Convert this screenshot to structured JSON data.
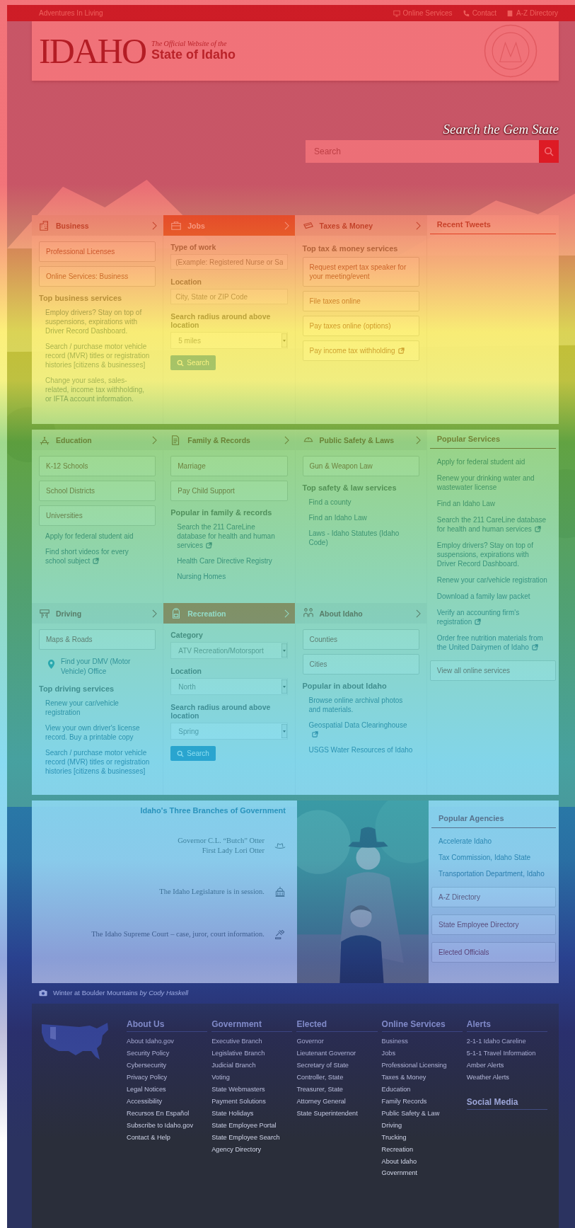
{
  "top_bar": {
    "tagline": "Adventures In Living",
    "links": [
      {
        "label": "Online Services"
      },
      {
        "label": "Contact"
      },
      {
        "label": "A-Z Directory"
      }
    ]
  },
  "header": {
    "logo": "IDAHO",
    "subtitle": "The Official Website of the",
    "title": "State of Idaho"
  },
  "hero": {
    "heading": "Search the Gem State",
    "search": {
      "placeholder": "Search"
    }
  },
  "sections": [
    {
      "title": "Business",
      "kind": "links",
      "blocks": [
        {
          "kind": "button",
          "label": "Professional Licenses"
        },
        {
          "kind": "button",
          "label": "Online Services: Business"
        },
        {
          "kind": "heading",
          "text": "Top business services"
        },
        {
          "kind": "link",
          "label": "Employ drivers? Stay on top of suspensions, expirations with Driver Record Dashboard."
        },
        {
          "kind": "link",
          "label": "Search / purchase motor vehicle record (MVR) titles or registration histories [citizens & businesses]"
        },
        {
          "kind": "link",
          "label": "Change your sales, sales-related, income tax withholding, or IFTA account information."
        }
      ]
    },
    {
      "title": "Jobs",
      "kind": "form",
      "blocks": [
        {
          "kind": "label",
          "text": "Type of work"
        },
        {
          "kind": "input",
          "placeholder": "(Example: Registered Nurse or Sa"
        },
        {
          "kind": "label",
          "text": "Location"
        },
        {
          "kind": "input",
          "placeholder": "City, State or ZIP Code"
        },
        {
          "kind": "label",
          "text": "Search radius around above location"
        },
        {
          "kind": "select",
          "value": "5 miles"
        },
        {
          "kind": "search_button",
          "label": "Search"
        }
      ]
    },
    {
      "title": "Taxes & Money",
      "kind": "links",
      "blocks": [
        {
          "kind": "heading",
          "text": "Top tax & money services"
        },
        {
          "kind": "button",
          "label": "Request expert tax speaker for your meeting/event"
        },
        {
          "kind": "button",
          "label": "File taxes online"
        },
        {
          "kind": "button",
          "label": "Pay taxes online (options)"
        },
        {
          "kind": "button",
          "label": "Pay income tax withholding",
          "external": true
        }
      ]
    },
    {
      "title": "Education",
      "kind": "links",
      "blocks": [
        {
          "kind": "button",
          "label": "K-12 Schools"
        },
        {
          "kind": "button",
          "label": "School Districts"
        },
        {
          "kind": "button",
          "label": "Universities"
        },
        {
          "kind": "link",
          "label": "Apply for federal student aid"
        },
        {
          "kind": "link",
          "label": "Find short videos for every school subject",
          "external": true
        }
      ]
    },
    {
      "title": "Family & Records",
      "kind": "links",
      "blocks": [
        {
          "kind": "button",
          "label": "Marriage"
        },
        {
          "kind": "button",
          "label": "Pay Child Support"
        },
        {
          "kind": "heading",
          "text": "Popular in family & records"
        },
        {
          "kind": "link",
          "label": "Search the 211 CareLine database for health and human services",
          "external": true
        },
        {
          "kind": "link",
          "label": "Health Care Directive Registry"
        },
        {
          "kind": "link",
          "label": "Nursing Homes"
        }
      ]
    },
    {
      "title": "Public Safety & Laws",
      "kind": "links",
      "blocks": [
        {
          "kind": "button",
          "label": "Gun & Weapon Law"
        },
        {
          "kind": "heading",
          "text": "Top safety & law services"
        },
        {
          "kind": "link",
          "label": "Find a county"
        },
        {
          "kind": "link",
          "label": "Find an Idaho Law"
        },
        {
          "kind": "link",
          "label": "Laws - Idaho Statutes (Idaho Code)"
        }
      ]
    },
    {
      "title": "Driving",
      "kind": "links",
      "blocks": [
        {
          "kind": "button",
          "label": "Maps & Roads"
        },
        {
          "kind": "location",
          "label": "Find your DMV (Motor Vehicle) Office"
        },
        {
          "kind": "heading",
          "text": "Top driving services"
        },
        {
          "kind": "link",
          "label": "Renew your car/vehicle registration"
        },
        {
          "kind": "link",
          "label": "View your own driver's license record. Buy a printable copy"
        },
        {
          "kind": "link",
          "label": "Search / purchase motor vehicle record (MVR) titles or registration histories [citizens & businesses]"
        }
      ]
    },
    {
      "title": "Recreation",
      "kind": "form",
      "blocks": [
        {
          "kind": "label",
          "text": "Category"
        },
        {
          "kind": "select",
          "value": "ATV Recreation/Motorsport"
        },
        {
          "kind": "label",
          "text": "Location"
        },
        {
          "kind": "select",
          "value": "North"
        },
        {
          "kind": "label",
          "text": "Search radius around above location"
        },
        {
          "kind": "select",
          "value": "Spring"
        },
        {
          "kind": "search_button",
          "label": "Search"
        }
      ]
    },
    {
      "title": "About Idaho",
      "kind": "links",
      "blocks": [
        {
          "kind": "button",
          "label": "Counties"
        },
        {
          "kind": "button",
          "label": "Cities"
        },
        {
          "kind": "heading",
          "text": "Popular in about Idaho"
        },
        {
          "kind": "link",
          "label": "Browse online archival photos and materials."
        },
        {
          "kind": "link",
          "label": "Geospatial Data Clearinghouse",
          "external": true
        },
        {
          "kind": "link",
          "label": "USGS Water Resources of Idaho"
        }
      ]
    }
  ],
  "side_panels": [
    {
      "title": "Recent Tweets"
    },
    {
      "title": "Popular Services",
      "blocks": [
        {
          "kind": "link",
          "label": "Apply for federal student aid"
        },
        {
          "kind": "link",
          "label": "Renew your drinking water and wastewater license"
        },
        {
          "kind": "link",
          "label": "Find an Idaho Law"
        },
        {
          "kind": "link",
          "label": "Search the 211 CareLine database for health and human services",
          "external": true
        },
        {
          "kind": "link",
          "label": "Employ drivers? Stay on top of suspensions, expirations with Driver Record Dashboard."
        },
        {
          "kind": "link",
          "label": "Renew your car/vehicle registration"
        },
        {
          "kind": "link",
          "label": "Download a family law packet"
        },
        {
          "kind": "link",
          "label": "Verify an accounting firm's registration",
          "external": true
        },
        {
          "kind": "link",
          "label": "Order free nutrition materials from the United Dairymen of Idaho",
          "external": true
        },
        {
          "kind": "button",
          "label": "View all online services"
        }
      ]
    }
  ],
  "branches": {
    "title": "Idaho's Three Branches of Government",
    "items": [
      {
        "lines": [
          "Governor C.L. “Butch” Otter",
          "First Lady Lori Otter"
        ]
      },
      {
        "lines": [
          "The Idaho Legislature is in session."
        ]
      },
      {
        "lines": [
          "The Idaho Supreme Court – case, juror, court information."
        ]
      }
    ]
  },
  "agencies": {
    "title": "Popular Agencies",
    "blocks": [
      {
        "kind": "link",
        "label": "Accelerate Idaho"
      },
      {
        "kind": "link",
        "label": "Tax Commission, Idaho State"
      },
      {
        "kind": "link",
        "label": "Transportation Department, Idaho"
      },
      {
        "kind": "button",
        "label": "A-Z Directory"
      },
      {
        "kind": "button",
        "label": "State Employee Directory"
      },
      {
        "kind": "button",
        "label": "Elected Officials"
      }
    ]
  },
  "caption": "Winter at Boulder Mountains *by Cody Haskell*",
  "footer": {
    "columns": [
      {
        "groups": [
          {
            "title": "About Us",
            "links": [
              "About Idaho.gov",
              "Security Policy",
              "Cybersecurity",
              "Privacy Policy",
              "Legal Notices",
              "Accessibility",
              "Recursos En Español",
              "Subscribe to Idaho.gov",
              "Contact & Help"
            ]
          }
        ]
      },
      {
        "groups": [
          {
            "title": "Government",
            "links": [
              "Executive Branch",
              "Legislative Branch",
              "Judicial Branch",
              "Voting",
              "State Webmasters",
              "Payment Solutions",
              "State Holidays",
              "State Employee Portal",
              "State Employee Search",
              "Agency Directory"
            ]
          }
        ]
      },
      {
        "groups": [
          {
            "title": "Elected",
            "links": [
              "Governor",
              "Lieutenant Governor",
              "Secretary of State",
              "Controller, State",
              "Treasurer, State",
              "Attorney General",
              "State Superintendent"
            ]
          }
        ]
      },
      {
        "groups": [
          {
            "title": "Online Services",
            "links": [
              "Business",
              "Jobs",
              "Professional Licensing",
              "Taxes & Money",
              "Education",
              "Family Records",
              "Public Safety & Law",
              "Driving",
              "Trucking",
              "Recreation",
              "About Idaho",
              "Government"
            ]
          }
        ]
      },
      {
        "groups": [
          {
            "title": "Alerts",
            "links": [
              "2-1-1 Idaho Careline",
              "5-1-1 Travel Information",
              "Amber Alerts",
              "Weather Alerts"
            ]
          },
          {
            "title": "Social Media"
          }
        ]
      }
    ]
  }
}
